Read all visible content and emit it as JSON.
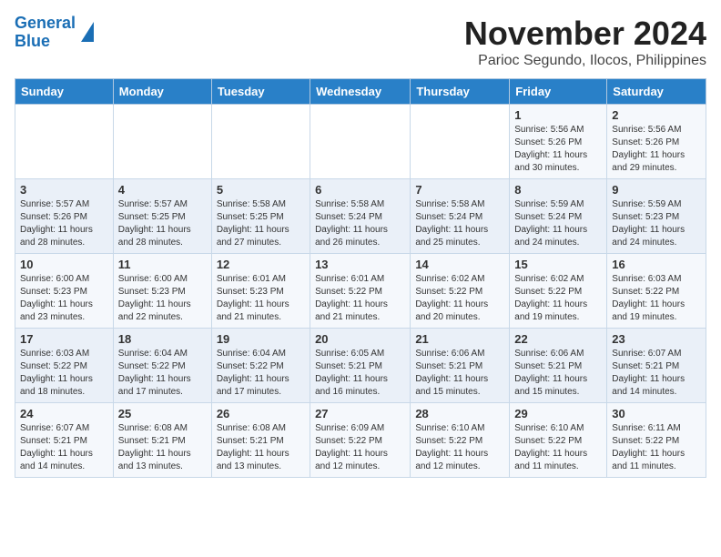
{
  "header": {
    "logo_line1": "General",
    "logo_line2": "Blue",
    "title": "November 2024",
    "subtitle": "Parioc Segundo, Ilocos, Philippines"
  },
  "weekdays": [
    "Sunday",
    "Monday",
    "Tuesday",
    "Wednesday",
    "Thursday",
    "Friday",
    "Saturday"
  ],
  "weeks": [
    [
      {
        "day": "",
        "info": ""
      },
      {
        "day": "",
        "info": ""
      },
      {
        "day": "",
        "info": ""
      },
      {
        "day": "",
        "info": ""
      },
      {
        "day": "",
        "info": ""
      },
      {
        "day": "1",
        "info": "Sunrise: 5:56 AM\nSunset: 5:26 PM\nDaylight: 11 hours and 30 minutes."
      },
      {
        "day": "2",
        "info": "Sunrise: 5:56 AM\nSunset: 5:26 PM\nDaylight: 11 hours and 29 minutes."
      }
    ],
    [
      {
        "day": "3",
        "info": "Sunrise: 5:57 AM\nSunset: 5:26 PM\nDaylight: 11 hours and 28 minutes."
      },
      {
        "day": "4",
        "info": "Sunrise: 5:57 AM\nSunset: 5:25 PM\nDaylight: 11 hours and 28 minutes."
      },
      {
        "day": "5",
        "info": "Sunrise: 5:58 AM\nSunset: 5:25 PM\nDaylight: 11 hours and 27 minutes."
      },
      {
        "day": "6",
        "info": "Sunrise: 5:58 AM\nSunset: 5:24 PM\nDaylight: 11 hours and 26 minutes."
      },
      {
        "day": "7",
        "info": "Sunrise: 5:58 AM\nSunset: 5:24 PM\nDaylight: 11 hours and 25 minutes."
      },
      {
        "day": "8",
        "info": "Sunrise: 5:59 AM\nSunset: 5:24 PM\nDaylight: 11 hours and 24 minutes."
      },
      {
        "day": "9",
        "info": "Sunrise: 5:59 AM\nSunset: 5:23 PM\nDaylight: 11 hours and 24 minutes."
      }
    ],
    [
      {
        "day": "10",
        "info": "Sunrise: 6:00 AM\nSunset: 5:23 PM\nDaylight: 11 hours and 23 minutes."
      },
      {
        "day": "11",
        "info": "Sunrise: 6:00 AM\nSunset: 5:23 PM\nDaylight: 11 hours and 22 minutes."
      },
      {
        "day": "12",
        "info": "Sunrise: 6:01 AM\nSunset: 5:23 PM\nDaylight: 11 hours and 21 minutes."
      },
      {
        "day": "13",
        "info": "Sunrise: 6:01 AM\nSunset: 5:22 PM\nDaylight: 11 hours and 21 minutes."
      },
      {
        "day": "14",
        "info": "Sunrise: 6:02 AM\nSunset: 5:22 PM\nDaylight: 11 hours and 20 minutes."
      },
      {
        "day": "15",
        "info": "Sunrise: 6:02 AM\nSunset: 5:22 PM\nDaylight: 11 hours and 19 minutes."
      },
      {
        "day": "16",
        "info": "Sunrise: 6:03 AM\nSunset: 5:22 PM\nDaylight: 11 hours and 19 minutes."
      }
    ],
    [
      {
        "day": "17",
        "info": "Sunrise: 6:03 AM\nSunset: 5:22 PM\nDaylight: 11 hours and 18 minutes."
      },
      {
        "day": "18",
        "info": "Sunrise: 6:04 AM\nSunset: 5:22 PM\nDaylight: 11 hours and 17 minutes."
      },
      {
        "day": "19",
        "info": "Sunrise: 6:04 AM\nSunset: 5:22 PM\nDaylight: 11 hours and 17 minutes."
      },
      {
        "day": "20",
        "info": "Sunrise: 6:05 AM\nSunset: 5:21 PM\nDaylight: 11 hours and 16 minutes."
      },
      {
        "day": "21",
        "info": "Sunrise: 6:06 AM\nSunset: 5:21 PM\nDaylight: 11 hours and 15 minutes."
      },
      {
        "day": "22",
        "info": "Sunrise: 6:06 AM\nSunset: 5:21 PM\nDaylight: 11 hours and 15 minutes."
      },
      {
        "day": "23",
        "info": "Sunrise: 6:07 AM\nSunset: 5:21 PM\nDaylight: 11 hours and 14 minutes."
      }
    ],
    [
      {
        "day": "24",
        "info": "Sunrise: 6:07 AM\nSunset: 5:21 PM\nDaylight: 11 hours and 14 minutes."
      },
      {
        "day": "25",
        "info": "Sunrise: 6:08 AM\nSunset: 5:21 PM\nDaylight: 11 hours and 13 minutes."
      },
      {
        "day": "26",
        "info": "Sunrise: 6:08 AM\nSunset: 5:21 PM\nDaylight: 11 hours and 13 minutes."
      },
      {
        "day": "27",
        "info": "Sunrise: 6:09 AM\nSunset: 5:22 PM\nDaylight: 11 hours and 12 minutes."
      },
      {
        "day": "28",
        "info": "Sunrise: 6:10 AM\nSunset: 5:22 PM\nDaylight: 11 hours and 12 minutes."
      },
      {
        "day": "29",
        "info": "Sunrise: 6:10 AM\nSunset: 5:22 PM\nDaylight: 11 hours and 11 minutes."
      },
      {
        "day": "30",
        "info": "Sunrise: 6:11 AM\nSunset: 5:22 PM\nDaylight: 11 hours and 11 minutes."
      }
    ]
  ]
}
